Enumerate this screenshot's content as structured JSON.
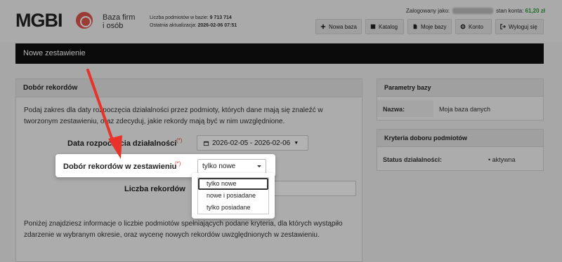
{
  "header": {
    "logo": "MGBI",
    "logo_sub_1": "Baza firm",
    "logo_sub_2": "i osób",
    "db_count_label": "Liczba podmiotów w bazie:",
    "db_count": "9 713 714",
    "last_update_label": "Ostatnia aktualizacja:",
    "last_update": "2026-02-06 07:51",
    "logged_as_label": "Zalogowany jako:",
    "balance_label": "stan konta:",
    "balance": "61,20 zł"
  },
  "nav": {
    "new_db": "Nowa baza",
    "catalog": "Katalog",
    "my_dbs": "Moje bazy",
    "account": "Konto",
    "logout": "Wyloguj się"
  },
  "title_bar": "Nowe zestawienie",
  "main": {
    "panel_title": "Dobór rekordów",
    "intro": "Podaj zakres dla daty rozpoczęcia działalności przez podmioty, których dane mają się znaleźć w tworzonym zestawieniu, oraz zdecyduj, jakie rekordy mają być w nim uwzględnione.",
    "date_label": "Data rozpoczęcia działalności",
    "required_mark": "(*)",
    "date_range": "2026-02-05 - 2026-02-06",
    "selection_label": "Dobór rekordów w zestawieniu",
    "selection_value": "tylko nowe",
    "count_label": "Liczba rekordów",
    "lower_text": "Poniżej znajdziesz informacje o liczbie podmiotów spełniających podane kryteria, dla których wystąpiło zdarzenie w wybranym okresie, oraz wycenę nowych rekordów uwzględnionych w zestawieniu."
  },
  "dropdown": {
    "options": [
      "tylko nowe",
      "nowe i posiadane",
      "tylko posiadane"
    ]
  },
  "params": {
    "title": "Parametry bazy",
    "name_key": "Nazwa:",
    "name_val": "Moja baza danych"
  },
  "criteria": {
    "title": "Kryteria doboru podmiotów",
    "status_key": "Status działalności:",
    "status_val": "aktywna"
  },
  "colors": {
    "accent_red": "#e0564e",
    "balance_green": "#2d9b34",
    "arrow_red": "#e8322a"
  }
}
